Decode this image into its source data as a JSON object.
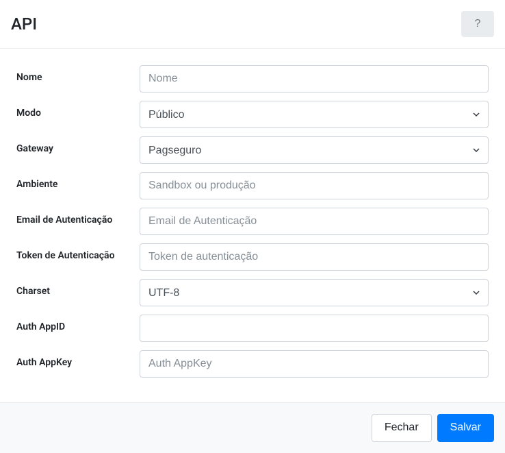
{
  "header": {
    "title": "API",
    "help": "?"
  },
  "form": {
    "nome": {
      "label": "Nome",
      "placeholder": "Nome",
      "value": ""
    },
    "modo": {
      "label": "Modo",
      "selected": "Público"
    },
    "gateway": {
      "label": "Gateway",
      "selected": "Pagseguro"
    },
    "ambiente": {
      "label": "Ambiente",
      "placeholder": "Sandbox ou produção",
      "value": ""
    },
    "email": {
      "label": "Email de Autenticação",
      "placeholder": "Email de Autenticação",
      "value": ""
    },
    "token": {
      "label": "Token de Autenticação",
      "placeholder": "Token de autenticação",
      "value": ""
    },
    "charset": {
      "label": "Charset",
      "selected": "UTF-8"
    },
    "appid": {
      "label": "Auth AppID",
      "placeholder": "",
      "value": ""
    },
    "appkey": {
      "label": "Auth AppKey",
      "placeholder": "Auth AppKey",
      "value": ""
    }
  },
  "footer": {
    "close": "Fechar",
    "save": "Salvar"
  }
}
